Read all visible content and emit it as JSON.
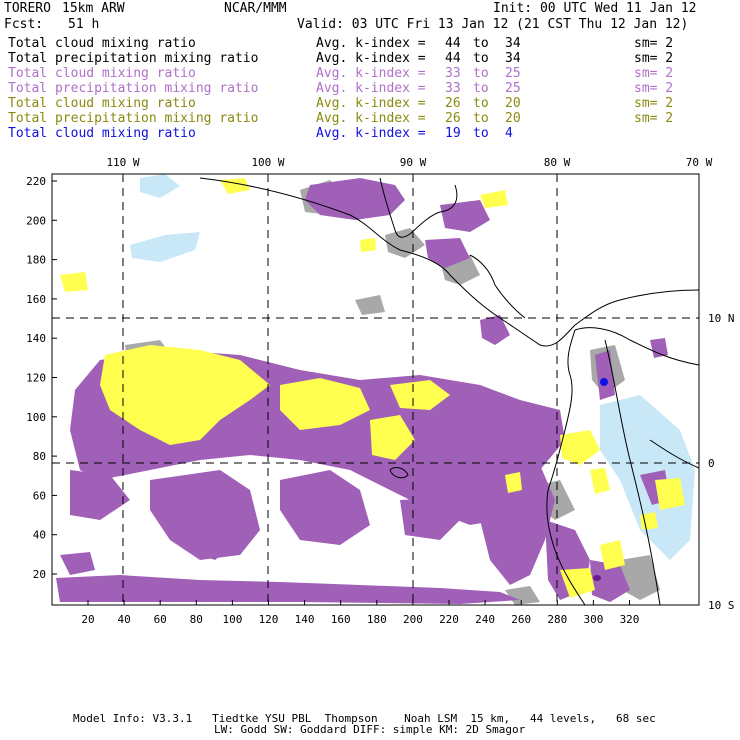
{
  "header": {
    "model": "TORERO",
    "resolution": "15km ARW",
    "center": "NCAR/MMM",
    "init": "Init: 00 UTC Wed 11 Jan 12",
    "fcst_label": "Fcst:",
    "fcst_value": "51 h",
    "valid": "Valid: 03 UTC Fri 13 Jan 12 (21 CST Thu 12 Jan 12)"
  },
  "legend": [
    {
      "field": "Total cloud mixing ratio",
      "kindex": "Avg. k-index =",
      "from": "44",
      "to_word": "to",
      "to": "34",
      "sm": "sm= 2",
      "color": "#000000"
    },
    {
      "field": "Total precipitation mixing ratio",
      "kindex": "Avg. k-index =",
      "from": "44",
      "to_word": "to",
      "to": "34",
      "sm": "sm= 2",
      "color": "#000000"
    },
    {
      "field": "Total cloud mixing ratio",
      "kindex": "Avg. k-index =",
      "from": "33",
      "to_word": "to",
      "to": "25",
      "sm": "sm= 2",
      "color": "#b070c8"
    },
    {
      "field": "Total precipitation mixing ratio",
      "kindex": "Avg. k-index =",
      "from": "33",
      "to_word": "to",
      "to": "25",
      "sm": "sm= 2",
      "color": "#b070c8"
    },
    {
      "field": "Total cloud mixing ratio",
      "kindex": "Avg. k-index =",
      "from": "26",
      "to_word": "to",
      "to": "20",
      "sm": "sm= 2",
      "color": "#8a8a10"
    },
    {
      "field": "Total precipitation mixing ratio",
      "kindex": "Avg. k-index =",
      "from": "26",
      "to_word": "to",
      "to": "20",
      "sm": "sm= 2",
      "color": "#8a8a10"
    },
    {
      "field": "Total cloud mixing ratio",
      "kindex": "Avg. k-index =",
      "from": "19",
      "to_word": "to",
      "to": "4",
      "sm": "",
      "color": "#1010e0"
    }
  ],
  "map": {
    "lon_labels": [
      "110 W",
      "100 W",
      "90 W",
      "80 W",
      "70 W"
    ],
    "lat_labels": [
      "10 N",
      "0",
      "10 S"
    ],
    "x_ticks": [
      "20",
      "40",
      "60",
      "80",
      "100",
      "120",
      "140",
      "160",
      "180",
      "200",
      "220",
      "240",
      "260",
      "280",
      "300",
      "320"
    ],
    "y_ticks": [
      "220",
      "200",
      "180",
      "160",
      "140",
      "120",
      "100",
      "80",
      "60",
      "40",
      "20"
    ],
    "colors": {
      "purple": "#a060b8",
      "yellow": "#ffff50",
      "gray": "#a8a8a8",
      "lightblue": "#c8e8f8",
      "coast": "#000000"
    }
  },
  "footer": {
    "line1": "Model Info: V3.3.1   Tiedtke YSU PBL  Thompson    Noah LSM  15 km,   44 levels,   68 sec",
    "line2": "LW: Godd SW: Goddard DIFF: simple KM: 2D Smagor"
  }
}
